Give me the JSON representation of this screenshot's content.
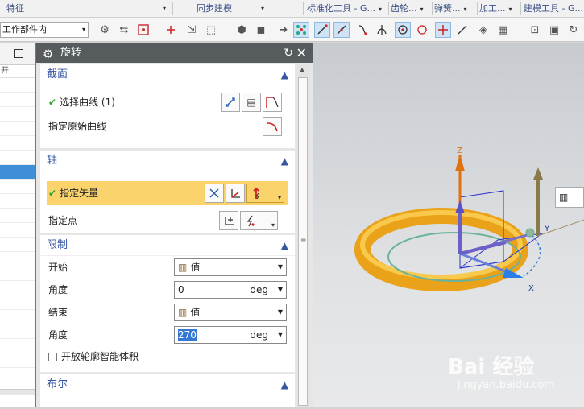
{
  "topbar": {
    "groups": [
      {
        "label": "特征"
      },
      {
        "label": "同步建模"
      },
      {
        "label": "标准化工具 - G..."
      },
      {
        "label": "齿轮..."
      },
      {
        "label": "弹簧..."
      },
      {
        "label": "加工..."
      },
      {
        "label": "建模工具 - G..."
      }
    ]
  },
  "toolbar": {
    "filter_value": "工作部件内"
  },
  "nav": {
    "column_header": "开"
  },
  "dialog": {
    "title": "旋转",
    "sections": {
      "section_profile": {
        "title": "截面",
        "select_curve_label": "选择曲线 (1)",
        "original_curve_label": "指定原始曲线"
      },
      "axis": {
        "title": "轴",
        "vector_label": "指定矢量",
        "point_label": "指定点"
      },
      "limits": {
        "title": "限制",
        "start_label": "开始",
        "start_option": "值",
        "start_angle_label": "角度",
        "start_angle_value": "0",
        "start_unit": "deg",
        "end_label": "结束",
        "end_option": "值",
        "end_angle_label": "角度",
        "end_angle_value": "270",
        "end_unit": "deg",
        "open_profile_label": "开放轮廓智能体积"
      },
      "boolean": {
        "title": "布尔"
      }
    }
  },
  "viewport": {
    "axis_labels": {
      "z": "Z",
      "y": "Y",
      "x": "X"
    },
    "watermark": "Bai 经验",
    "watermark_url": "jingyan.baidu.com"
  },
  "colors": {
    "title_bar": "#565b5e",
    "section_title": "#3657a0",
    "highlight": "#fbd36c",
    "torus": "#f0a818",
    "check": "#2aa02a"
  }
}
